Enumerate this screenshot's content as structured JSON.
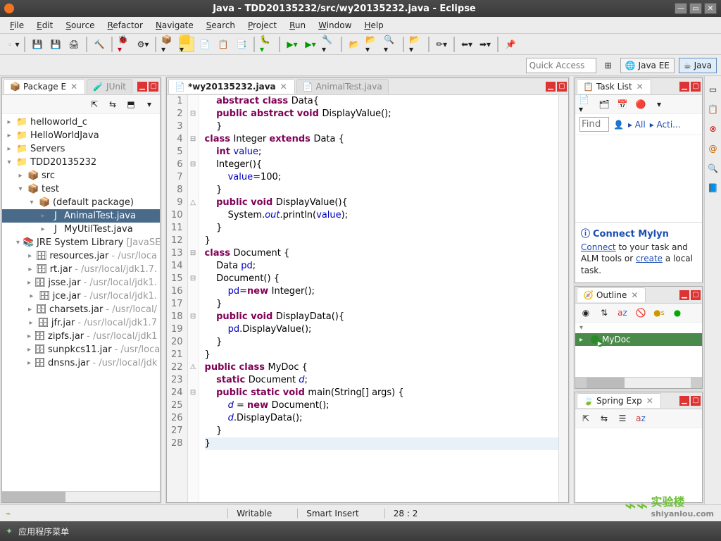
{
  "window": {
    "title": "Java - TDD20135232/src/wy20135232.java - Eclipse"
  },
  "menu": [
    "File",
    "Edit",
    "Source",
    "Refactor",
    "Navigate",
    "Search",
    "Project",
    "Run",
    "Window",
    "Help"
  ],
  "quick_access": "Quick Access",
  "perspectives": [
    {
      "label": "Java EE",
      "active": false
    },
    {
      "label": "Java",
      "active": true
    }
  ],
  "package_explorer": {
    "title": "Package E",
    "alt_tab": "JUnit",
    "tree": [
      {
        "d": 0,
        "exp": "col",
        "icon": "📁",
        "label": "helloworld_c"
      },
      {
        "d": 0,
        "exp": "col",
        "icon": "📁",
        "label": "HelloWorldJava"
      },
      {
        "d": 0,
        "exp": "col",
        "icon": "📁",
        "label": "Servers"
      },
      {
        "d": 0,
        "exp": "exp",
        "icon": "📁",
        "label": "TDD20135232"
      },
      {
        "d": 1,
        "exp": "col",
        "icon": "📦",
        "label": "src"
      },
      {
        "d": 1,
        "exp": "exp",
        "icon": "📦",
        "label": "test"
      },
      {
        "d": 2,
        "exp": "exp",
        "icon": "📦",
        "label": "(default package)"
      },
      {
        "d": 3,
        "exp": "col",
        "icon": "J",
        "label": "AnimalTest.java",
        "sel": true
      },
      {
        "d": 3,
        "exp": "col",
        "icon": "J",
        "label": "MyUtilTest.java"
      },
      {
        "d": 1,
        "exp": "exp",
        "icon": "📚",
        "label": "JRE System Library",
        "suffix": "[JavaSE"
      },
      {
        "d": 2,
        "exp": "col",
        "icon": "🗄",
        "label": "resources.jar",
        "suffix": " - /usr/loca"
      },
      {
        "d": 2,
        "exp": "col",
        "icon": "🗄",
        "label": "rt.jar",
        "suffix": " - /usr/local/jdk1.7."
      },
      {
        "d": 2,
        "exp": "col",
        "icon": "🗄",
        "label": "jsse.jar",
        "suffix": " - /usr/local/jdk1."
      },
      {
        "d": 2,
        "exp": "col",
        "icon": "🗄",
        "label": "jce.jar",
        "suffix": " - /usr/local/jdk1."
      },
      {
        "d": 2,
        "exp": "col",
        "icon": "🗄",
        "label": "charsets.jar",
        "suffix": " - /usr/local/"
      },
      {
        "d": 2,
        "exp": "col",
        "icon": "🗄",
        "label": "jfr.jar",
        "suffix": " - /usr/local/jdk1.7"
      },
      {
        "d": 2,
        "exp": "col",
        "icon": "🗄",
        "label": "zipfs.jar",
        "suffix": " - /usr/local/jdk1"
      },
      {
        "d": 2,
        "exp": "col",
        "icon": "🗄",
        "label": "sunpkcs11.jar",
        "suffix": " - /usr/loca"
      },
      {
        "d": 2,
        "exp": "col",
        "icon": "🗄",
        "label": "dnsns.jar",
        "suffix": " - /usr/local/jdk"
      }
    ]
  },
  "editor": {
    "tabs": [
      {
        "label": "*wy20135232.java",
        "active": true,
        "dirty": true
      },
      {
        "label": "AnimalTest.java",
        "active": false,
        "dirty": false
      }
    ],
    "lines": [
      {
        "n": 1,
        "ind": 1,
        "tokens": [
          [
            "k",
            "abstract class "
          ],
          [
            "t",
            "Data{"
          ]
        ]
      },
      {
        "n": 2,
        "ind": 1,
        "fold": "-",
        "tokens": [
          [
            "k",
            "public abstract void "
          ],
          [
            "t",
            "DisplayValue();"
          ]
        ]
      },
      {
        "n": 3,
        "ind": 1,
        "tokens": [
          [
            "t",
            "}"
          ]
        ]
      },
      {
        "n": 4,
        "ind": 0,
        "fold": "-",
        "tokens": [
          [
            "k",
            "class "
          ],
          [
            "t",
            "Integer "
          ],
          [
            "k",
            "extends "
          ],
          [
            "t",
            "Data {"
          ]
        ]
      },
      {
        "n": 5,
        "ind": 1,
        "tokens": [
          [
            "k",
            "int "
          ],
          [
            "f",
            "value"
          ],
          [
            "t",
            ";"
          ]
        ]
      },
      {
        "n": 6,
        "ind": 1,
        "fold": "-",
        "tokens": [
          [
            "t",
            "Integer(){"
          ]
        ]
      },
      {
        "n": 7,
        "ind": 2,
        "tokens": [
          [
            "f",
            "value"
          ],
          [
            "t",
            "=100;"
          ]
        ]
      },
      {
        "n": 8,
        "ind": 1,
        "tokens": [
          [
            "t",
            "}"
          ]
        ]
      },
      {
        "n": 9,
        "ind": 1,
        "fold": "-",
        "mark": "△",
        "tokens": [
          [
            "k",
            "public void "
          ],
          [
            "t",
            "DisplayValue(){"
          ]
        ]
      },
      {
        "n": 10,
        "ind": 2,
        "tokens": [
          [
            "t",
            "System."
          ],
          [
            "fi",
            "out"
          ],
          [
            "t",
            ".println("
          ],
          [
            "f",
            "value"
          ],
          [
            "t",
            ");"
          ]
        ]
      },
      {
        "n": 11,
        "ind": 1,
        "tokens": [
          [
            "t",
            "}"
          ]
        ]
      },
      {
        "n": 12,
        "ind": 0,
        "tokens": [
          [
            "t",
            "}"
          ]
        ]
      },
      {
        "n": 13,
        "ind": 0,
        "fold": "-",
        "tokens": [
          [
            "k",
            "class "
          ],
          [
            "t",
            "Document {"
          ]
        ]
      },
      {
        "n": 14,
        "ind": 1,
        "tokens": [
          [
            "t",
            "Data "
          ],
          [
            "f",
            "pd"
          ],
          [
            "t",
            ";"
          ]
        ]
      },
      {
        "n": 15,
        "ind": 1,
        "fold": "-",
        "tokens": [
          [
            "t",
            "Document() {"
          ]
        ]
      },
      {
        "n": 16,
        "ind": 2,
        "tokens": [
          [
            "f",
            "pd"
          ],
          [
            "t",
            "="
          ],
          [
            "k",
            "new "
          ],
          [
            "t",
            "Integer();"
          ]
        ]
      },
      {
        "n": 17,
        "ind": 1,
        "tokens": [
          [
            "t",
            "}"
          ]
        ]
      },
      {
        "n": 18,
        "ind": 1,
        "fold": "-",
        "tokens": [
          [
            "k",
            "public void "
          ],
          [
            "t",
            "DisplayData(){"
          ]
        ]
      },
      {
        "n": 19,
        "ind": 2,
        "tokens": [
          [
            "f",
            "pd"
          ],
          [
            "t",
            ".DisplayValue();"
          ]
        ]
      },
      {
        "n": 20,
        "ind": 1,
        "tokens": [
          [
            "t",
            "}"
          ]
        ]
      },
      {
        "n": 21,
        "ind": 0,
        "tokens": [
          [
            "t",
            "}"
          ]
        ]
      },
      {
        "n": 22,
        "ind": 0,
        "fold": "-",
        "mark": "⚠",
        "tokens": [
          [
            "k",
            "public class "
          ],
          [
            "t",
            "MyDoc {"
          ]
        ]
      },
      {
        "n": 23,
        "ind": 1,
        "tokens": [
          [
            "k",
            "static "
          ],
          [
            "t",
            "Document "
          ],
          [
            "fi",
            "d"
          ],
          [
            "t",
            ";"
          ]
        ]
      },
      {
        "n": 24,
        "ind": 1,
        "fold": "-",
        "tokens": [
          [
            "k",
            "public static void "
          ],
          [
            "t",
            "main(String[] "
          ],
          [
            "n",
            "args"
          ],
          [
            "t",
            ") {"
          ]
        ]
      },
      {
        "n": 25,
        "ind": 2,
        "tokens": [
          [
            "fi",
            "d"
          ],
          [
            "t",
            " = "
          ],
          [
            "k",
            "new "
          ],
          [
            "t",
            "Document();"
          ]
        ]
      },
      {
        "n": 26,
        "ind": 2,
        "tokens": [
          [
            "fi",
            "d"
          ],
          [
            "t",
            ".DisplayData();"
          ]
        ]
      },
      {
        "n": 27,
        "ind": 1,
        "tokens": [
          [
            "t",
            "}"
          ]
        ]
      },
      {
        "n": 28,
        "ind": 0,
        "cl": true,
        "tokens": [
          [
            "t",
            "}"
          ]
        ]
      }
    ]
  },
  "tasklist": {
    "title": "Task List",
    "find": "Find",
    "links": [
      "All",
      "Acti..."
    ]
  },
  "mylyn": {
    "heading": "Connect Mylyn",
    "body_pre": "Connect",
    "body_mid": " to your task and ALM tools or ",
    "body_link": "create",
    "body_post": " a local task."
  },
  "outline": {
    "title": "Outline",
    "item": "MyDoc"
  },
  "spring": {
    "title": "Spring Exp"
  },
  "status": {
    "writable": "Writable",
    "insert": "Smart Insert",
    "pos": "28 : 2"
  },
  "taskbar": {
    "label": "应用程序菜单"
  },
  "brand": {
    "cn": "实验楼",
    "en": "shiyanlou.com"
  }
}
